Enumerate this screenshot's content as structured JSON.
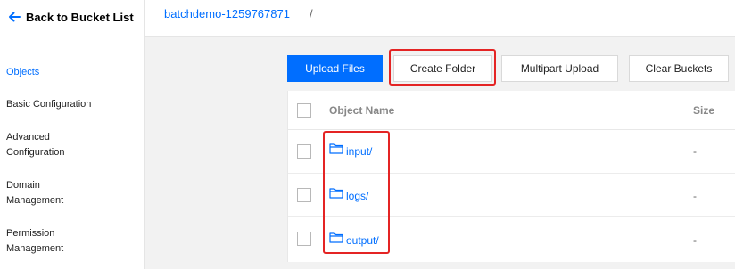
{
  "sidebar": {
    "back_label": "Back to Bucket List",
    "items": [
      {
        "label": "Objects"
      },
      {
        "label": "Basic Configuration"
      },
      {
        "label": "Advanced Configuration"
      },
      {
        "label": "Domain Management"
      },
      {
        "label": "Permission Management"
      }
    ]
  },
  "breadcrumb": {
    "bucket": "batchdemo-1259767871",
    "separator": "/"
  },
  "toolbar": {
    "upload_label": "Upload Files",
    "create_folder_label": "Create Folder",
    "multipart_label": "Multipart Upload",
    "clear_label": "Clear Buckets"
  },
  "table": {
    "columns": {
      "name": "Object Name",
      "size": "Size"
    },
    "rows": [
      {
        "name": "input/",
        "size": "-"
      },
      {
        "name": "logs/",
        "size": "-"
      },
      {
        "name": "output/",
        "size": "-"
      }
    ]
  },
  "colors": {
    "accent": "#006eff",
    "highlight": "#e42424"
  }
}
